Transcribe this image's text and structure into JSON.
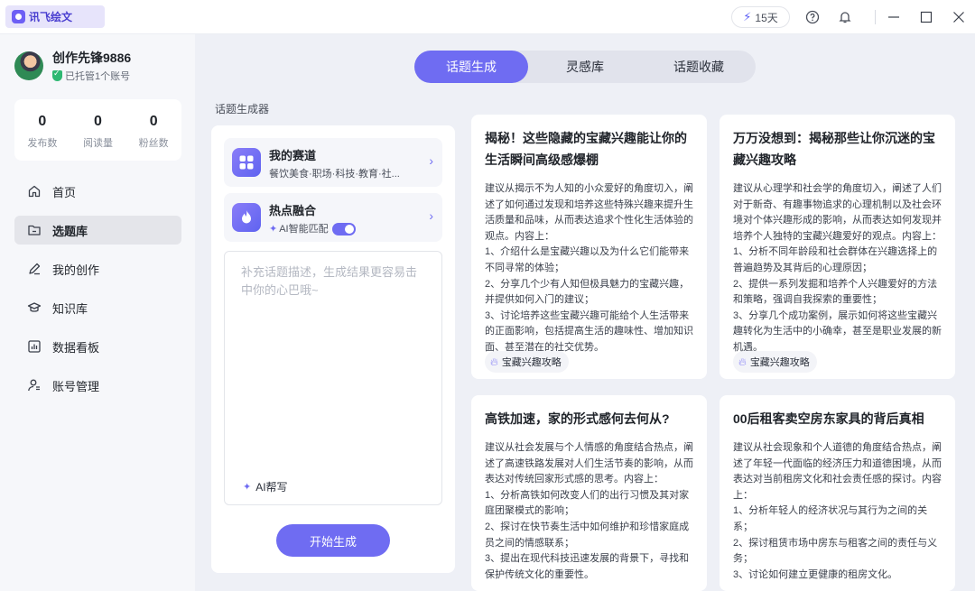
{
  "app": {
    "name": "讯飞绘文",
    "energy": "15天"
  },
  "user": {
    "name": "创作先锋9886",
    "managed": "已托管1个账号",
    "stats": [
      {
        "value": "0",
        "label": "发布数"
      },
      {
        "value": "0",
        "label": "阅读量"
      },
      {
        "value": "0",
        "label": "粉丝数"
      }
    ]
  },
  "nav": [
    {
      "label": "首页"
    },
    {
      "label": "选题库"
    },
    {
      "label": "我的创作"
    },
    {
      "label": "知识库"
    },
    {
      "label": "数据看板"
    },
    {
      "label": "账号管理"
    }
  ],
  "tabs": [
    "话题生成",
    "灵感库",
    "话题收藏"
  ],
  "generator": {
    "label": "话题生成器",
    "track_title": "我的赛道",
    "track_sub": "餐饮美食·职场·科技·教育·社...",
    "hot_title": "热点融合",
    "hot_sub": "AI智能匹配",
    "placeholder": "补充话题描述，生成结果更容易击中你的心巴哦~",
    "ai_help": "AI帮写",
    "start": "开始生成"
  },
  "cards": [
    {
      "title": "揭秘！这些隐藏的宝藏兴趣能让你的生活瞬间高级感爆棚",
      "body": "建议从揭示不为人知的小众爱好的角度切入，阐述了如何通过发现和培养这些特殊兴趣来提升生活质量和品味，从而表达追求个性化生活体验的观点。内容上：\n1、介绍什么是宝藏兴趣以及为什么它们能带来不同寻常的体验；\n2、分享几个少有人知但极具魅力的宝藏兴趣，并提供如何入门的建议；\n3、讨论培养这些宝藏兴趣可能给个人生活带来的正面影响，包括提高生活的趣味性、增加知识面、甚至潜在的社交优势。",
      "tag": "宝藏兴趣攻略"
    },
    {
      "title": "万万没想到：揭秘那些让你沉迷的宝藏兴趣攻略",
      "body": "建议从心理学和社会学的角度切入，阐述了人们对于新奇、有趣事物追求的心理机制以及社会环境对个体兴趣形成的影响，从而表达如何发现并培养个人独特的宝藏兴趣爱好的观点。内容上：\n1、分析不同年龄段和社会群体在兴趣选择上的普遍趋势及其背后的心理原因；\n2、提供一系列发掘和培养个人兴趣爱好的方法和策略，强调自我探索的重要性；\n3、分享几个成功案例，展示如何将这些宝藏兴趣转化为生活中的小确幸，甚至是职业发展的新机遇。",
      "tag": "宝藏兴趣攻略"
    },
    {
      "title": "高铁加速，家的形式感何去何从?",
      "body": "建议从社会发展与个人情感的角度结合热点，阐述了高速铁路发展对人们生活节奏的影响，从而表达对传统回家形式感的思考。内容上：\n1、分析高铁如何改变人们的出行习惯及其对家庭团聚模式的影响；\n2、探讨在快节奏生活中如何维护和珍惜家庭成员之间的情感联系；\n3、提出在现代科技迅速发展的背景下，寻找和保护传统文化的重要性。",
      "tag": ""
    },
    {
      "title": "00后租客卖空房东家具的背后真相",
      "body": "建议从社会现象和个人道德的角度结合热点，阐述了年轻一代面临的经济压力和道德困境，从而表达对当前租房文化和社会责任感的探讨。内容上：\n1、分析年轻人的经济状况与其行为之间的关系；\n2、探讨租赁市场中房东与租客之间的责任与义务；\n3、讨论如何建立更健康的租房文化。",
      "tag": ""
    }
  ]
}
